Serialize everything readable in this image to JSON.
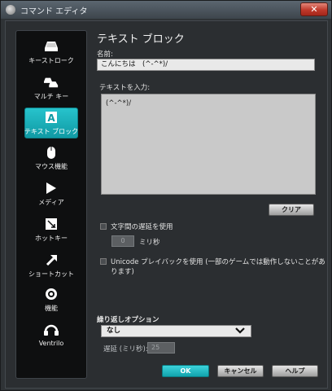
{
  "window": {
    "title": "コマンド エディタ",
    "close": "✕"
  },
  "sidebar": {
    "items": [
      {
        "label": "キーストローク",
        "icon": "key-icon"
      },
      {
        "label": "マルチ キー",
        "icon": "multi-key-icon"
      },
      {
        "label": "テキスト ブロック",
        "icon": "text-block-icon",
        "glyph": "A",
        "active": true
      },
      {
        "label": "マウス機能",
        "icon": "mouse-icon"
      },
      {
        "label": "メディア",
        "icon": "play-icon"
      },
      {
        "label": "ホットキー",
        "icon": "hotkey-icon"
      },
      {
        "label": "ショートカット",
        "icon": "shortcut-arrow-icon"
      },
      {
        "label": "機能",
        "icon": "function-icon"
      },
      {
        "label": "Ventrilo",
        "icon": "ventrilo-headset-icon"
      }
    ]
  },
  "main": {
    "title": "テキスト ブロック",
    "name_label": "名前:",
    "name_value": "こんにちは　(^-^*)/",
    "text_label": "テキストを入力:",
    "text_value": "(^-^*)/",
    "clear_button": "クリア",
    "char_delay_label": "文字間の遅延を使用",
    "char_delay_value": "0",
    "char_delay_unit": "ミリ秒",
    "unicode_label": "Unicode プレイバックを使用 (一部のゲームでは動作しないことがあります)"
  },
  "repeat": {
    "title": "繰り返しオプション",
    "selected": "なし",
    "delay_label": "遅延 (ミリ秒):",
    "delay_value": "25"
  },
  "footer": {
    "ok": "OK",
    "cancel": "キャンセル",
    "help": "ヘルプ"
  },
  "colors": {
    "accent": "#1ab4bd",
    "background": "#2b2e31",
    "sidebar": "#0e0f10"
  }
}
